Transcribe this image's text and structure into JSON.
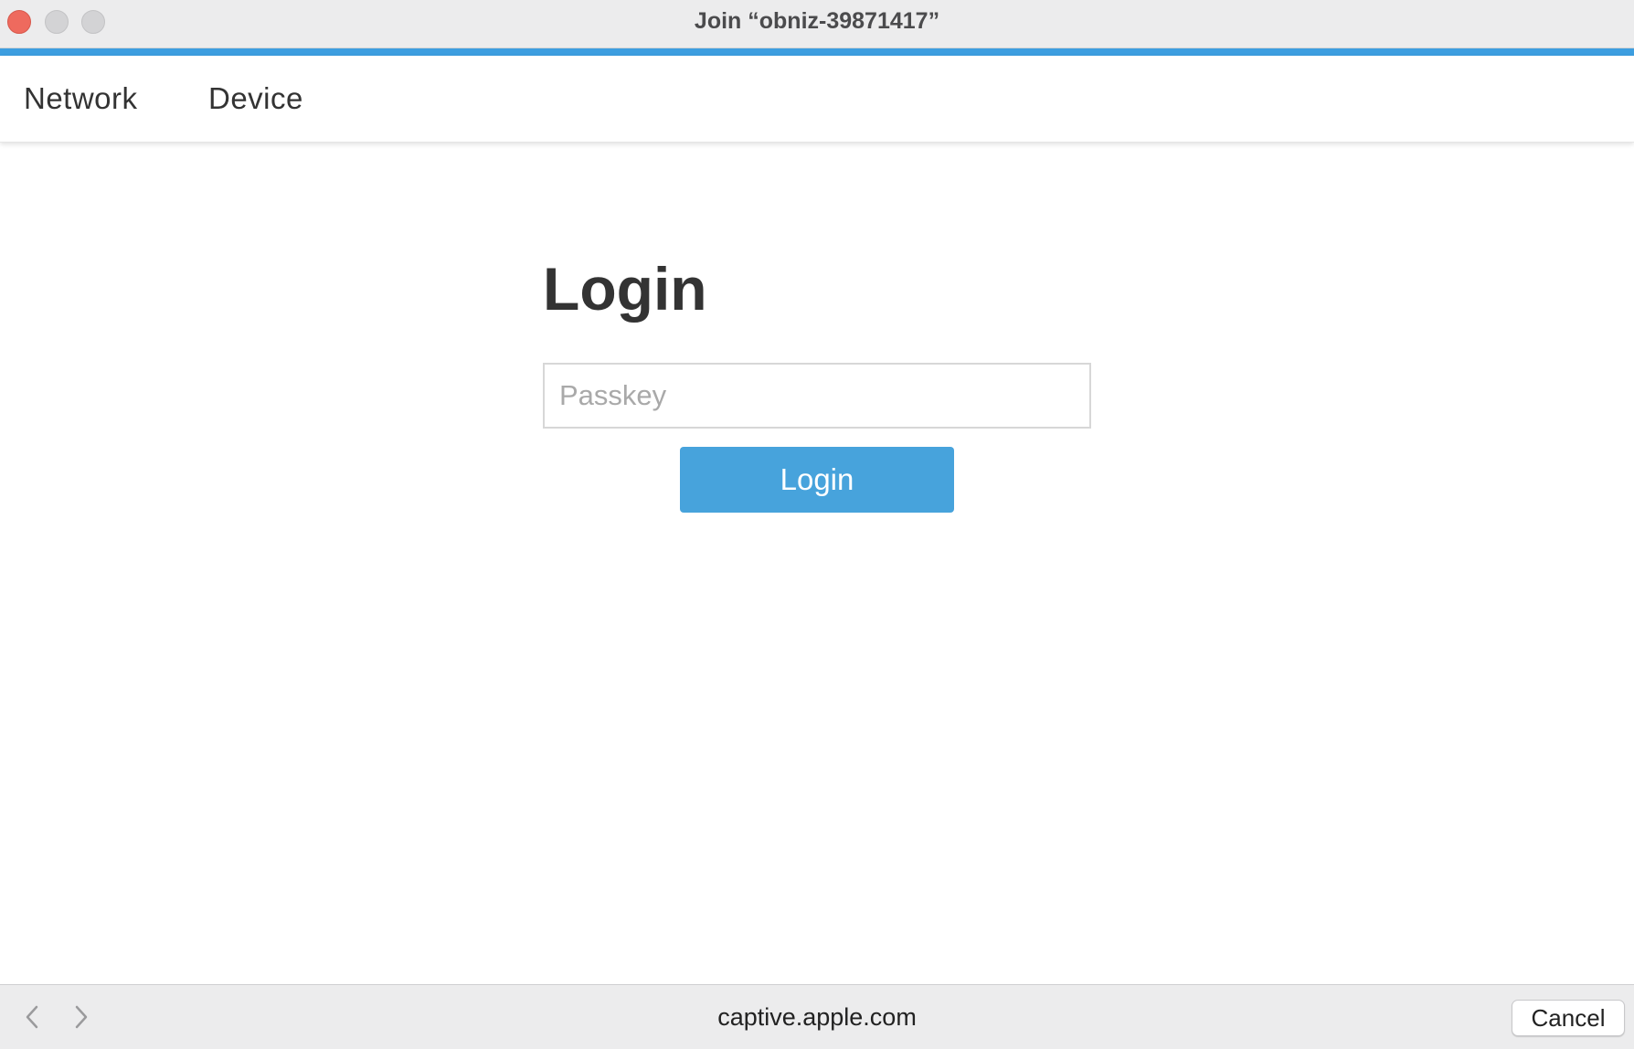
{
  "window": {
    "title": "Join “obniz-39871417”"
  },
  "nav": {
    "items": [
      {
        "label": "Network"
      },
      {
        "label": "Device"
      }
    ]
  },
  "login": {
    "heading": "Login",
    "passkey_placeholder": "Passkey",
    "passkey_value": "",
    "button_label": "Login"
  },
  "bottombar": {
    "url": "captive.apple.com",
    "cancel_label": "Cancel"
  },
  "colors": {
    "accent": "#3d9ee0",
    "button": "#47a3dc",
    "close_button": "#ee6a5e"
  },
  "icons": {
    "back": "chevron-left-icon",
    "forward": "chevron-right-icon"
  }
}
